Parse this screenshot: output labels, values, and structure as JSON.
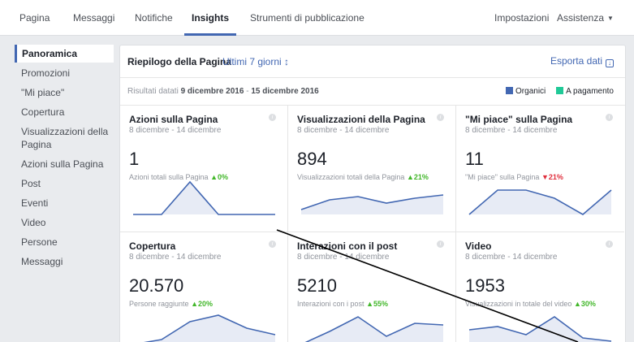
{
  "topnav": {
    "tabs": [
      "Pagina",
      "Messaggi",
      "Notifiche",
      "Insights",
      "Strumenti di pubblicazione"
    ],
    "settings": "Impostazioni",
    "help": "Assistenza",
    "active": "Insights"
  },
  "sidebar": {
    "items": [
      "Panoramica",
      "Promozioni",
      "\"Mi piace\"",
      "Copertura",
      "Visualizzazioni della Pagina",
      "Azioni sulla Pagina",
      "Post",
      "Eventi",
      "Video",
      "Persone",
      "Messaggi"
    ],
    "active": "Panoramica"
  },
  "panel": {
    "title": "Riepilogo della Pagina",
    "range": "Ultimi 7 giorni ↕",
    "export": "Esporta dati",
    "results_prefix": "Risultati datati",
    "results_from": "9 dicembre 2016",
    "results_sep": " - ",
    "results_to": "15 dicembre 2016",
    "legend": {
      "organic": "Organici",
      "paid": "A pagamento",
      "organic_color": "#4267b2",
      "paid_color": "#20c997"
    }
  },
  "cards": [
    {
      "title": "Azioni sulla Pagina",
      "dates": "8 dicembre - 14 dicembre",
      "value": "1",
      "subtitle": "Azioni totali sulla Pagina",
      "change": "▲0%",
      "dir": "up",
      "series": [
        0,
        0,
        1,
        0,
        0,
        0
      ]
    },
    {
      "title": "Visualizzazioni della Pagina",
      "dates": "8 dicembre - 14 dicembre",
      "value": "894",
      "subtitle": "Visualizzazioni totali della Pagina",
      "change": "▲21%",
      "dir": "up",
      "series": [
        0.15,
        0.45,
        0.55,
        0.35,
        0.5,
        0.6
      ]
    },
    {
      "title": "\"Mi piace\" sulla Pagina",
      "dates": "8 dicembre - 14 dicembre",
      "value": "11",
      "subtitle": "\"Mi piace\" sulla Pagina",
      "change": "▼21%",
      "dir": "down",
      "series": [
        0,
        0.75,
        0.75,
        0.5,
        0,
        0.75
      ]
    },
    {
      "title": "Copertura",
      "dates": "8 dicembre - 14 dicembre",
      "value": "20.570",
      "subtitle": "Persone raggiunte",
      "change": "▲20%",
      "dir": "up",
      "series": [
        0.1,
        0.25,
        0.8,
        1,
        0.6,
        0.4
      ]
    },
    {
      "title": "Interazioni con il post",
      "dates": "8 dicembre - 14 dicembre",
      "value": "5210",
      "subtitle": "Interazioni con i post",
      "change": "▲55%",
      "dir": "up",
      "series": [
        0.1,
        0.5,
        0.95,
        0.35,
        0.75,
        0.7
      ]
    },
    {
      "title": "Video",
      "dates": "8 dicembre - 14 dicembre",
      "value": "1953",
      "subtitle": "Visualizzazioni in totale del video",
      "change": "▲30%",
      "dir": "up",
      "series": [
        0.55,
        0.65,
        0.4,
        0.95,
        0.3,
        0.2
      ]
    }
  ]
}
